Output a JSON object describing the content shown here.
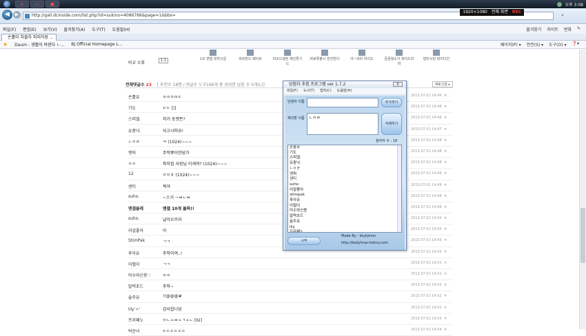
{
  "taskbar": {
    "btn3": "■",
    "resolution": "1920×1080",
    "region": "전체 화면",
    "rec": "REC",
    "time": "오후 3:08"
  },
  "browser": {
    "url": "http://gall.dcinside.com/list.php?id=sukino=4086766&page=1&bbs=",
    "menu": [
      "파일(F)",
      "편집(E)",
      "보기(V)",
      "즐겨찾기(A)",
      "도구(T)",
      "도움말(H)"
    ],
    "menu_right": [
      "즐겨찾기",
      "차이트",
      "변화",
      "✎"
    ],
    "tab": "손홀미 차출하 피피하장 ...",
    "favorites": [
      "Daum - 생활이 바뀐다 ㄴ...",
      "BJ Official Homepage  L..."
    ],
    "fav_right": [
      "페이지(P) ▾",
      "안전(S) ▾",
      "도구(O) ▾",
      "❓▾"
    ]
  },
  "topstrip": {
    "items": [
      "1조 면접 대학구글",
      "피르한드 메이트",
      "비오드넬린 제인튜기드",
      "따로튜블시 한잔한다",
      "아~쉬타 위이드",
      "곰곰청소가 파이드라마",
      "밥타시탄 파이다간",
      "를래게모드 사원하게~"
    ],
    "compare": "비교 소화",
    "check": "1 1"
  },
  "list": {
    "header_label": "전체댓글수",
    "header_count": "23",
    "header_note": "[ 추천수 18명 / 댓글수 누구168개 중 상위한 남음 수 5개(L)] ",
    "refresh": "새로고침 ▸",
    "rows": [
      {
        "nick": "손홀유",
        "msg": "ㅇㅇㅇㅁㄷ",
        "time": "2013.07.01 14:46"
      },
      {
        "nick": "기도",
        "msg": "ㄷㄷ [i]",
        "time": "2013.07.01 14:46"
      },
      {
        "nick": "스피델.",
        "msg": "저거 포켓몬?",
        "time": "2013.07.01 14:46"
      },
      {
        "nick": "유충낙.",
        "msg": "되고시퍼요!",
        "time": "2013.07.01 14:47"
      },
      {
        "nick": "ㄴㅇㄹ",
        "msg": "ㅋ   (1024)~~~",
        "time": "2013.07.01 14:48"
      },
      {
        "nick": "엣퍼",
        "msg": "주작뽀이얀당가",
        "time": "2013.07.01 14:48"
      },
      {
        "nick": "ㅇㅇ",
        "msg": "피자집 사장님 이세여?   (1024)~~~",
        "time": "2013.07.01 14:48"
      },
      {
        "nick": "12",
        "msg": "ㅠㅠㅎ   (1024)~~~",
        "time": "2013.07.01 14:49"
      },
      {
        "nick": "센티",
        "msg": "목야",
        "time": "2013.07.01 14:49"
      },
      {
        "nick": "suho.",
        "msg": "~스거 ㅡㅂㄴㅂ",
        "time": "2013.07.01 14:49"
      },
      {
        "nick": "앤갤들레",
        "msg": "앤갤 10개 돌파!!",
        "time": "2013.07.01 14:49"
      },
      {
        "nick": "suho.",
        "msg": "날아오르라",
        "time": "2013.07.01 14:50"
      },
      {
        "nick": "리얼좋아",
        "msg": "아",
        "time": "2013.07.01 14:50"
      },
      {
        "nick": "StimPak",
        "msg": "ㄱㄱ",
        "time": "2013.07.01 14:50"
      },
      {
        "nick": "후아유",
        "msg": "주작이여..!",
        "time": "2013.07.01 14:50"
      },
      {
        "nick": "어찔이",
        "msg": "ㄱㄱ",
        "time": "2013.07.01 14:51"
      },
      {
        "nick": "미수와신용♡",
        "msg": "ㅇㅇ",
        "time": "2013.07.01 14:51"
      },
      {
        "nick": "말력초드",
        "msg": "주작~",
        "time": "2013.07.01 14:52"
      },
      {
        "nick": "술주유",
        "msg": "!!@@@#",
        "time": "2013.07.01 14:52"
      },
      {
        "nick": "lily'ㅅ'",
        "msg": "감사합니당",
        "time": "2013.07.01 14:52"
      },
      {
        "nick": "프라페노",
        "msg": "ㅠㄴㅅㅂㅅㄱㅅㄴ [IU]",
        "time": "2013.07.01 14:53"
      },
      {
        "nick": "박순녀",
        "msg": "ㄷㄷㄷㄷㄷㄷ",
        "time": "2013.07.01 14:54"
      }
    ]
  },
  "dialog": {
    "title": "당첨자 추첨 프로그램 ver 1.7.2",
    "close": "X",
    "menu": [
      "파일(F)",
      "도구(T)",
      "캡처(C)",
      "도움말(H)"
    ],
    "label_name": "당첨자 이름",
    "label_exclude": "제외할 이름",
    "exclude_value": "ㄴㅇㄹ",
    "add": "추가하기",
    "remove": "삭제하기",
    "count_label": "참여자 수 : 18",
    "entries": [
      "손홀유",
      "기도",
      "스피델.",
      "유충낙.",
      "ㄴㅇㄹ",
      "엣퍼",
      "센티",
      "suho",
      "리얼좋아",
      "stimpak",
      "후아유",
      "어찔이",
      "미수와신용",
      "말력초드",
      "술주유",
      "lily",
      "프라페노"
    ],
    "start": "시작",
    "credit": "Made By - btykjmnn",
    "url": "http://bodyhnar.tistory.com"
  }
}
